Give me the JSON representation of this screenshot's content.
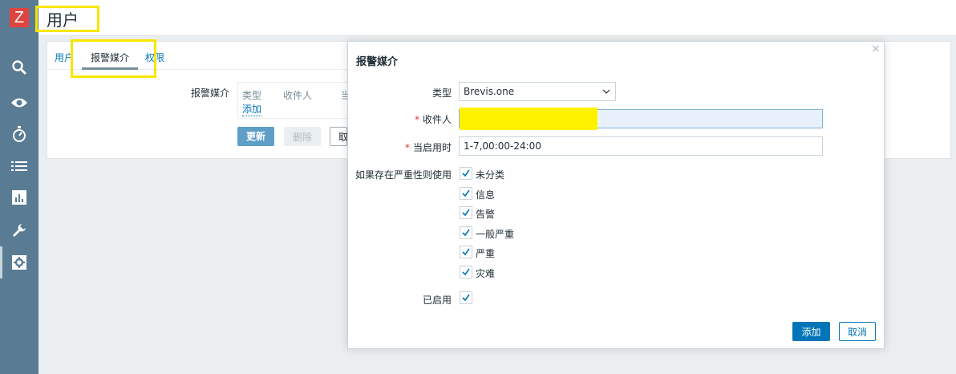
{
  "brand": {
    "logo": "Z",
    "accent": "#e0443f"
  },
  "sidebar": {
    "icons": [
      "search-icon",
      "eye-icon",
      "stopwatch-icon",
      "list-icon",
      "bar-chart-icon",
      "wrench-icon",
      "gear-icon"
    ]
  },
  "header": {
    "title": "用户"
  },
  "tabs": [
    {
      "label": "用户"
    },
    {
      "label": "报警媒介"
    },
    {
      "label": "权限"
    }
  ],
  "media": {
    "label": "报警媒介",
    "columns": [
      "类型",
      "收件人",
      "当"
    ],
    "add_link": "添加"
  },
  "actions": {
    "update": "更新",
    "delete": "删除",
    "cancel_partial": "取"
  },
  "modal": {
    "title": "报警媒介",
    "close": "×",
    "type_label": "类型",
    "type_value": "Brevis.one",
    "recipient_label": "收件人",
    "recipient_value": "",
    "when_active_label": "当启用时",
    "when_active_value": "1-7,00:00-24:00",
    "severity_label": "如果存在严重性则使用",
    "severities": [
      {
        "label": "未分类",
        "checked": true
      },
      {
        "label": "信息",
        "checked": true
      },
      {
        "label": "告警",
        "checked": true
      },
      {
        "label": "一般严重",
        "checked": true
      },
      {
        "label": "严重",
        "checked": true
      },
      {
        "label": "灾难",
        "checked": true
      }
    ],
    "enabled_label": "已启用",
    "enabled": true,
    "add_button": "添加",
    "cancel_button": "取消"
  }
}
